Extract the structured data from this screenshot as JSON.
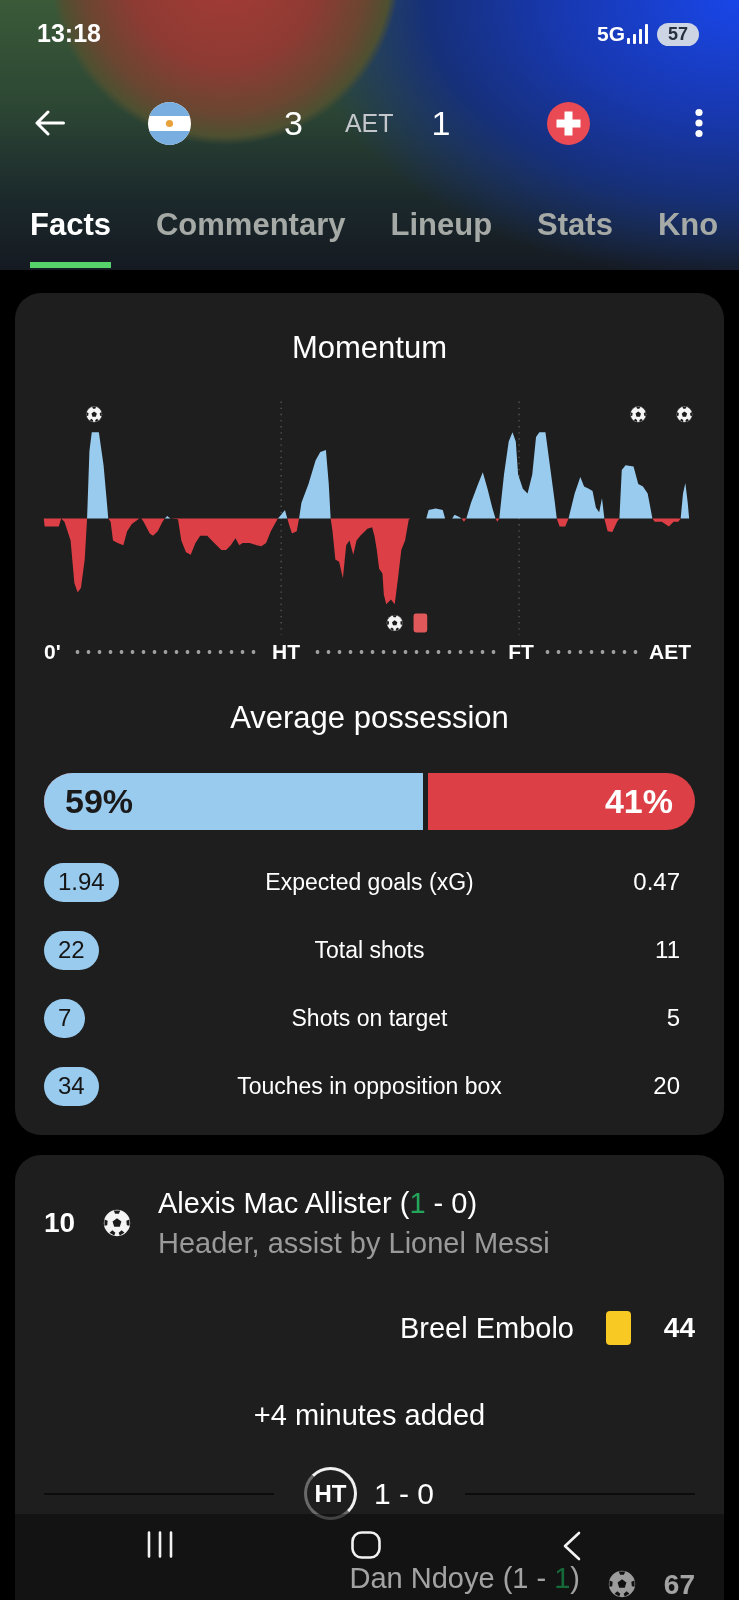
{
  "status_bar": {
    "time": "13:18",
    "network": "5G",
    "battery": "57"
  },
  "match_header": {
    "home_score": "3",
    "status": "AET",
    "away_score": "1"
  },
  "tabs": [
    {
      "label": "Facts",
      "selected": true
    },
    {
      "label": "Commentary",
      "selected": false
    },
    {
      "label": "Lineup",
      "selected": false
    },
    {
      "label": "Stats",
      "selected": false
    },
    {
      "label": "Kno",
      "selected": false
    }
  ],
  "momentum": {
    "title": "Momentum",
    "axis_labels": [
      "0'",
      "HT",
      "FT",
      "AET"
    ]
  },
  "possession": {
    "title": "Average possession",
    "level": 0.59,
    "home": "59%",
    "away": "41%"
  },
  "stats": [
    {
      "label": "Expected goals (xG)",
      "home": "1.94",
      "home_highlighted": true,
      "away": "0.47",
      "away_highlighted": false
    },
    {
      "label": "Total shots",
      "home": "22",
      "home_highlighted": true,
      "away": "11",
      "away_highlighted": false
    },
    {
      "label": "Shots on target",
      "home": "7",
      "home_highlighted": true,
      "away": "5",
      "away_highlighted": false
    },
    {
      "label": "Touches in opposition box",
      "home": "34",
      "home_highlighted": true,
      "away": "20",
      "away_highlighted": false
    }
  ],
  "events": [
    {
      "kind": "goal",
      "away": false,
      "minute": "10",
      "title": [
        {
          "text": "Alexis Mac Allister (",
          "highlight": false
        },
        {
          "text": "1",
          "highlight": true
        },
        {
          "text": " - 0)",
          "highlight": false
        }
      ],
      "detail": "Header, assist by Lionel Messi"
    },
    {
      "kind": "yellow_card",
      "away": true,
      "minute": "44",
      "player": "Breel Embolo"
    },
    {
      "kind": "added_time",
      "text": "+4 minutes added"
    },
    {
      "kind": "period",
      "badge": "HT",
      "score": "1 - 0"
    },
    {
      "kind": "goal",
      "away": true,
      "minute": "67",
      "title": [
        {
          "text": "Dan Ndoye (1 - ",
          "highlight": false
        },
        {
          "text": "1",
          "highlight": true
        },
        {
          "text": ")",
          "highlight": false
        }
      ]
    }
  ]
}
